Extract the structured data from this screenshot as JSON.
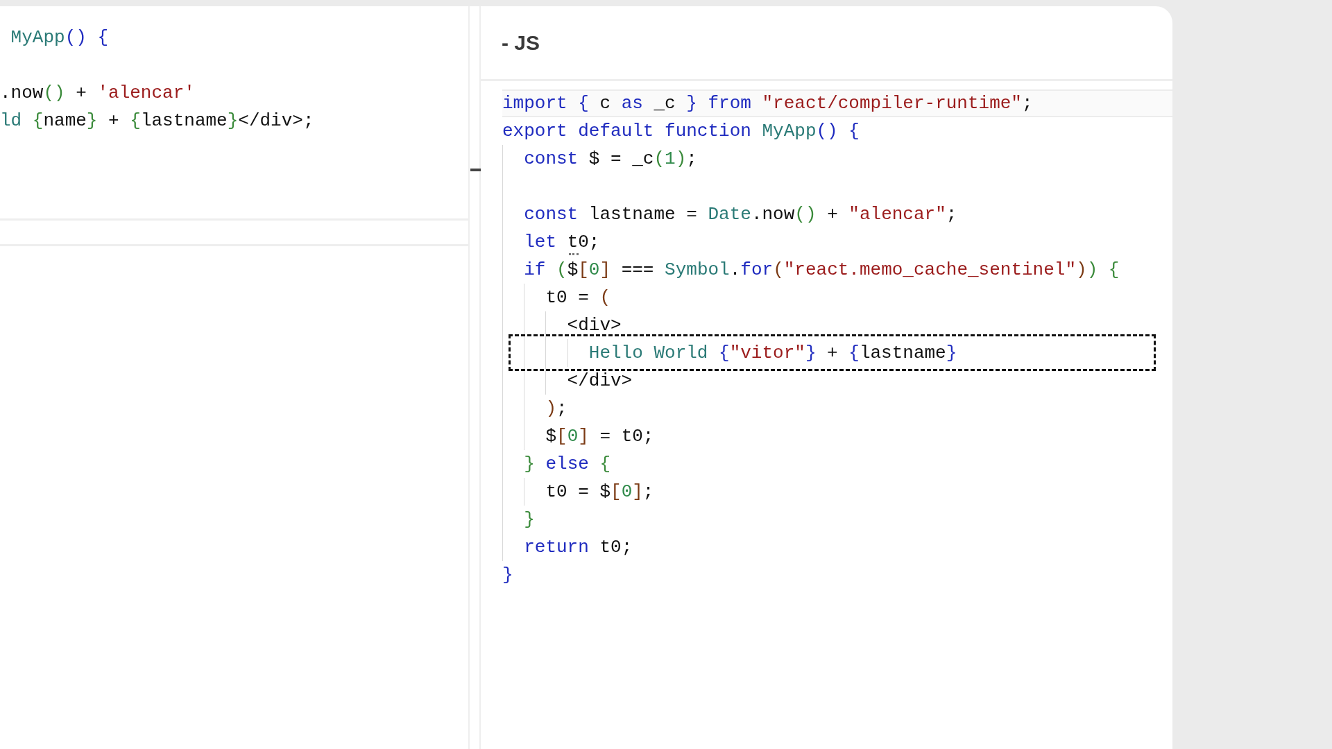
{
  "left_editor": {
    "lines": [
      {
        "kind": "code",
        "tokens": [
          {
            "kind": "fn",
            "text": " MyApp"
          },
          {
            "kind": "b1",
            "text": "() {"
          }
        ]
      },
      {
        "kind": "blank"
      },
      {
        "kind": "code",
        "tokens": [
          {
            "kind": "text",
            "text": ".now"
          },
          {
            "kind": "b2",
            "text": "()"
          },
          {
            "kind": "text",
            "text": " + "
          },
          {
            "kind": "str",
            "text": "'alencar'"
          }
        ]
      },
      {
        "kind": "code",
        "tokens": [
          {
            "kind": "fn",
            "text": "ld "
          },
          {
            "kind": "b2",
            "text": "{"
          },
          {
            "kind": "text",
            "text": "name"
          },
          {
            "kind": "b2",
            "text": "}"
          },
          {
            "kind": "text",
            "text": " + "
          },
          {
            "kind": "b2",
            "text": "{"
          },
          {
            "kind": "text",
            "text": "lastname"
          },
          {
            "kind": "b2",
            "text": "}"
          },
          {
            "kind": "text",
            "text": "</div>;"
          }
        ]
      }
    ]
  },
  "output_panel": {
    "title": "- JS",
    "lines": [
      {
        "kind": "code",
        "current": true,
        "tokens": [
          {
            "kind": "kw",
            "text": "import "
          },
          {
            "kind": "b1",
            "text": "{ "
          },
          {
            "kind": "text",
            "text": "c "
          },
          {
            "kind": "kw",
            "text": "as "
          },
          {
            "kind": "text",
            "text": "_c "
          },
          {
            "kind": "b1",
            "text": "} "
          },
          {
            "kind": "kw",
            "text": "from "
          },
          {
            "kind": "str",
            "text": "\"react/compiler-runtime\""
          },
          {
            "kind": "text",
            "text": ";"
          }
        ]
      },
      {
        "kind": "code",
        "tokens": [
          {
            "kind": "kw",
            "text": "export default function "
          },
          {
            "kind": "fn",
            "text": "MyApp"
          },
          {
            "kind": "b1",
            "text": "() {"
          }
        ],
        "children": [
          {
            "kind": "code",
            "tokens": [
              {
                "kind": "kw",
                "text": "const "
              },
              {
                "kind": "text",
                "text": "$ = _c"
              },
              {
                "kind": "b2",
                "text": "("
              },
              {
                "kind": "num",
                "text": "1"
              },
              {
                "kind": "b2",
                "text": ")"
              },
              {
                "kind": "text",
                "text": ";"
              }
            ]
          },
          {
            "kind": "blank"
          },
          {
            "kind": "code",
            "tokens": [
              {
                "kind": "kw",
                "text": "const "
              },
              {
                "kind": "text",
                "text": "lastname = "
              },
              {
                "kind": "fn",
                "text": "Date"
              },
              {
                "kind": "text",
                "text": ".now"
              },
              {
                "kind": "b2",
                "text": "()"
              },
              {
                "kind": "text",
                "text": " + "
              },
              {
                "kind": "str",
                "text": "\"alencar\""
              },
              {
                "kind": "text",
                "text": ";"
              }
            ]
          },
          {
            "kind": "code",
            "tokens": [
              {
                "kind": "kw",
                "text": "let "
              },
              {
                "kind": "text",
                "text": "t0",
                "hint": true
              },
              {
                "kind": "text",
                "text": ";"
              }
            ]
          },
          {
            "kind": "code",
            "tokens": [
              {
                "kind": "kw",
                "text": "if "
              },
              {
                "kind": "b2",
                "text": "("
              },
              {
                "kind": "text",
                "text": "$"
              },
              {
                "kind": "b3",
                "text": "["
              },
              {
                "kind": "num",
                "text": "0"
              },
              {
                "kind": "b3",
                "text": "]"
              },
              {
                "kind": "text",
                "text": " === "
              },
              {
                "kind": "fn",
                "text": "Symbol"
              },
              {
                "kind": "text",
                "text": "."
              },
              {
                "kind": "kw",
                "text": "for"
              },
              {
                "kind": "b3",
                "text": "("
              },
              {
                "kind": "str",
                "text": "\"react.memo_cache_sentinel\""
              },
              {
                "kind": "b3",
                "text": ")"
              },
              {
                "kind": "b2",
                "text": ") {"
              }
            ],
            "children": [
              {
                "kind": "code",
                "tokens": [
                  {
                    "kind": "text",
                    "text": "t0 = "
                  },
                  {
                    "kind": "b3",
                    "text": "("
                  }
                ],
                "children": [
                  {
                    "kind": "code",
                    "tokens": [
                      {
                        "kind": "text",
                        "text": "<div>"
                      }
                    ],
                    "children": [
                      {
                        "kind": "code",
                        "highlighted": true,
                        "tokens": [
                          {
                            "kind": "fn",
                            "text": "Hello World "
                          },
                          {
                            "kind": "b1",
                            "text": "{"
                          },
                          {
                            "kind": "str",
                            "text": "\"vitor\""
                          },
                          {
                            "kind": "b1",
                            "text": "}"
                          },
                          {
                            "kind": "text",
                            "text": " + "
                          },
                          {
                            "kind": "b1",
                            "text": "{"
                          },
                          {
                            "kind": "text",
                            "text": "lastname"
                          },
                          {
                            "kind": "b1",
                            "text": "}"
                          }
                        ]
                      }
                    ]
                  },
                  {
                    "kind": "code",
                    "tokens": [
                      {
                        "kind": "text",
                        "text": "</div>"
                      }
                    ]
                  }
                ]
              },
              {
                "kind": "code",
                "tokens": [
                  {
                    "kind": "b3",
                    "text": ")"
                  },
                  {
                    "kind": "text",
                    "text": ";"
                  }
                ]
              },
              {
                "kind": "code",
                "tokens": [
                  {
                    "kind": "text",
                    "text": "$"
                  },
                  {
                    "kind": "b3",
                    "text": "["
                  },
                  {
                    "kind": "num",
                    "text": "0"
                  },
                  {
                    "kind": "b3",
                    "text": "]"
                  },
                  {
                    "kind": "text",
                    "text": " = t0;"
                  }
                ]
              }
            ]
          },
          {
            "kind": "code",
            "tokens": [
              {
                "kind": "b2",
                "text": "} "
              },
              {
                "kind": "kw",
                "text": "else "
              },
              {
                "kind": "b2",
                "text": "{"
              }
            ],
            "children": [
              {
                "kind": "code",
                "tokens": [
                  {
                    "kind": "text",
                    "text": "t0 = $"
                  },
                  {
                    "kind": "b3",
                    "text": "["
                  },
                  {
                    "kind": "num",
                    "text": "0"
                  },
                  {
                    "kind": "b3",
                    "text": "]"
                  },
                  {
                    "kind": "text",
                    "text": ";"
                  }
                ]
              }
            ]
          },
          {
            "kind": "code",
            "tokens": [
              {
                "kind": "b2",
                "text": "}"
              }
            ]
          },
          {
            "kind": "code",
            "tokens": [
              {
                "kind": "kw",
                "text": "return "
              },
              {
                "kind": "text",
                "text": "t0;"
              }
            ]
          }
        ]
      },
      {
        "kind": "code",
        "tokens": [
          {
            "kind": "b1",
            "text": "}"
          }
        ]
      }
    ]
  }
}
